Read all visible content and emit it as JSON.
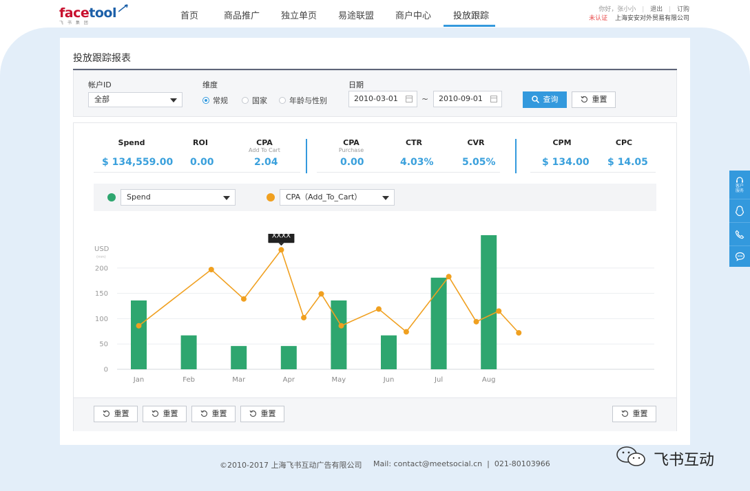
{
  "brand": {
    "logo_face": "face",
    "logo_tool": "tool",
    "logo_sub": "飞 书 集 团",
    "primary_color": "#3399dd",
    "logo_red": "#c8102e",
    "logo_blue": "#1b5fa8"
  },
  "nav": {
    "items": [
      {
        "label": "首页"
      },
      {
        "label": "商品推广"
      },
      {
        "label": "独立单页"
      },
      {
        "label": "易途联盟"
      },
      {
        "label": "商户中心"
      },
      {
        "label": "投放跟踪"
      }
    ],
    "active_index": 5
  },
  "user": {
    "greeting": "你好，张小小",
    "logout": "退出",
    "subscribe": "订购",
    "status": "未认证",
    "company": "上海安安对外贸易有限公司"
  },
  "page": {
    "title": "投放跟踪报表"
  },
  "filters": {
    "account_label": "帐户ID",
    "account_value": "全部",
    "dimension_label": "维度",
    "dimension_options": [
      {
        "label": "常规",
        "selected": true
      },
      {
        "label": "国家",
        "selected": false
      },
      {
        "label": "年龄与性别",
        "selected": false
      }
    ],
    "date_label": "日期",
    "date_from": "2010-03-01",
    "date_to": "2010-09-01",
    "date_sep": "~",
    "query_label": "查询",
    "reset_label": "重置"
  },
  "metrics": [
    {
      "label": "Spend",
      "sub": "",
      "value": "$ 134,559.00"
    },
    {
      "label": "ROI",
      "sub": "",
      "value": "0.00"
    },
    {
      "label": "CPA",
      "sub": "Add To Cart",
      "value": "2.04"
    },
    {
      "label": "CPA",
      "sub": "Purchase",
      "value": "0.00"
    },
    {
      "label": "CTR",
      "sub": "",
      "value": "4.03%"
    },
    {
      "label": "CVR",
      "sub": "",
      "value": "5.05%"
    },
    {
      "label": "CPM",
      "sub": "",
      "value": "$ 134.00"
    },
    {
      "label": "CPC",
      "sub": "",
      "value": "$ 14.05"
    }
  ],
  "series_selectors": [
    {
      "value": "Spend",
      "color": "#2ea66f"
    },
    {
      "value": "CPA（Add_To_Cart）",
      "color": "#f0a020"
    }
  ],
  "chart_data": {
    "type": "bar",
    "ylabel": "USD",
    "ylabel_unit": "(mm)",
    "ylim": [
      0,
      250
    ],
    "yticks": [
      0,
      50,
      100,
      150,
      200
    ],
    "grid": true,
    "categories": [
      "Jan",
      "Feb",
      "Mar",
      "Apr",
      "May",
      "Jun",
      "Jul",
      "Aug"
    ],
    "bars": {
      "color": "#2ea66f",
      "points": [
        {
          "x": 0,
          "value": 136
        },
        {
          "x": 1,
          "value": 67
        },
        {
          "x": 2,
          "value": 46
        },
        {
          "x": 3,
          "value": 46
        },
        {
          "x": 4,
          "value": 136
        },
        {
          "x": 5,
          "value": 67
        },
        {
          "x": 6,
          "value": 181
        },
        {
          "x": 7,
          "value": 272
        }
      ]
    },
    "line": {
      "color": "#f0a020",
      "points": [
        {
          "x": 0,
          "value": 86
        },
        {
          "x": 1.45,
          "value": 197
        },
        {
          "x": 2.1,
          "value": 139
        },
        {
          "x": 2.85,
          "value": 236
        },
        {
          "x": 3.3,
          "value": 102
        },
        {
          "x": 3.65,
          "value": 149
        },
        {
          "x": 4.05,
          "value": 86
        },
        {
          "x": 4.8,
          "value": 119
        },
        {
          "x": 5.35,
          "value": 74
        },
        {
          "x": 6.2,
          "value": 183
        },
        {
          "x": 6.75,
          "value": 94
        },
        {
          "x": 7.2,
          "value": 115
        },
        {
          "x": 7.6,
          "value": 72
        }
      ]
    },
    "tooltip": {
      "text": "XXXX",
      "x": 2.85,
      "value": 236
    }
  },
  "bottom_buttons": [
    "重置",
    "重置",
    "重置",
    "重置",
    "重置"
  ],
  "footer": {
    "copyright": "©2010-2017 上海飞书互动广告有限公司",
    "contact": "Mail: contact@meetsocial.cn  |  021-80103966"
  },
  "side_rail": {
    "service_label_1": "客户",
    "service_label_2": "服务"
  },
  "watermark": {
    "text": "飞书互动"
  }
}
